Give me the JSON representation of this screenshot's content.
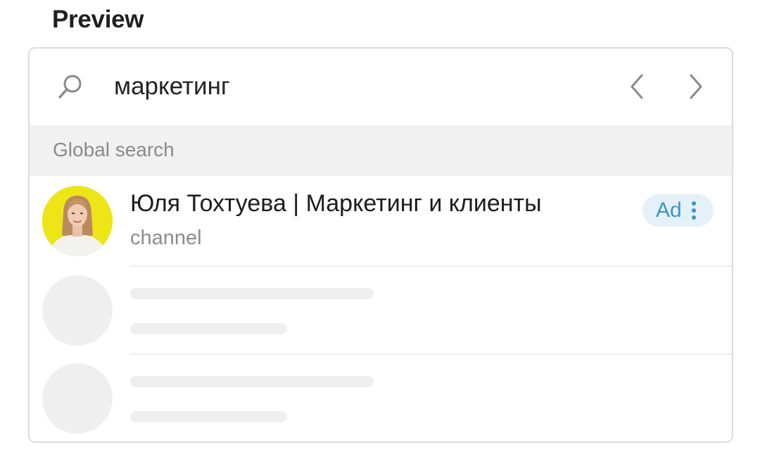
{
  "header": {
    "title": "Preview"
  },
  "search": {
    "query": "маркетинг",
    "icon": "search-icon",
    "prev_icon": "chevron-left-icon",
    "next_icon": "chevron-right-icon"
  },
  "section": {
    "label": "Global search"
  },
  "results": [
    {
      "title": "Юля Тохтуева | Маркетинг и клиенты",
      "subtitle": "channel",
      "badge": "Ad",
      "badge_menu_icon": "more-vertical-icon",
      "avatar_icon": "channel-avatar"
    }
  ],
  "placeholders": 2,
  "colors": {
    "accent": "#3d93c6",
    "badge_bg": "#e4f1f9",
    "section_bg": "#f1f1f1",
    "avatar_bg": "#eee517",
    "skeleton": "#efefef"
  }
}
